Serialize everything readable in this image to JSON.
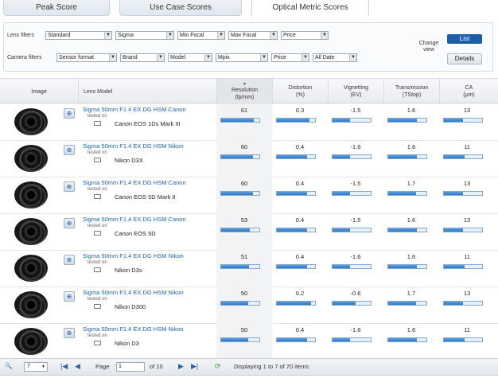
{
  "tabs": [
    "Peak Score",
    "Use Case Scores",
    "Optical Metric Scores"
  ],
  "filters": {
    "lens_label": "Lens filters",
    "lens": [
      {
        "value": "Standard"
      },
      {
        "value": "Sigma"
      },
      {
        "value": "Min Focal"
      },
      {
        "value": "Max Focal"
      },
      {
        "value": "Price"
      }
    ],
    "camera_label": "Camera filters",
    "camera": [
      {
        "value": "Sensor format"
      },
      {
        "value": "Brand"
      },
      {
        "value": "Model"
      },
      {
        "value": "Mpix"
      },
      {
        "value": "Price"
      },
      {
        "value": "All Date"
      }
    ],
    "change_view": "Change view",
    "list_label": "List",
    "details_label": "Details"
  },
  "columns": {
    "image": "Image",
    "model": "Lens Model",
    "resolution": [
      "Resolution",
      "(lp/mm)"
    ],
    "distortion": [
      "Distortion",
      "(%)"
    ],
    "vignetting": [
      "Vignetting",
      "(EV)"
    ],
    "transmission": [
      "Transmission",
      "(TStop)"
    ],
    "ca": [
      "CA",
      "(µm)"
    ]
  },
  "rows": [
    {
      "model": "Sigma 50mm F1.4 EX DG HSM Canon",
      "tested": "tested on",
      "camera": "Canon EOS 1Ds Mark III",
      "resolution": "61",
      "distortion": "0.3",
      "vignetting": "-1.5",
      "transmission": "1.6",
      "ca": "13",
      "bars": [
        0.85,
        0.85,
        0.45,
        0.75,
        0.5
      ]
    },
    {
      "model": "Sigma 50mm F1.4 EX DG HSM Nikon",
      "tested": "tested on",
      "camera": "Nikon D3X",
      "resolution": "60",
      "distortion": "0.4",
      "vignetting": "-1.6",
      "transmission": "1.6",
      "ca": "11",
      "bars": [
        0.84,
        0.8,
        0.45,
        0.75,
        0.55
      ]
    },
    {
      "model": "Sigma 50mm F1.4 EX DG HSM Canon",
      "tested": "tested on",
      "camera": "Canon EOS 5D Mark II",
      "resolution": "60",
      "distortion": "0.4",
      "vignetting": "-1.5",
      "transmission": "1.7",
      "ca": "13",
      "bars": [
        0.84,
        0.8,
        0.45,
        0.72,
        0.5
      ]
    },
    {
      "model": "Sigma 50mm F1.4 EX DG HSM Canon",
      "tested": "tested on",
      "camera": "Canon EOS 5D",
      "resolution": "53",
      "distortion": "0.4",
      "vignetting": "-1.5",
      "transmission": "1.6",
      "ca": "13",
      "bars": [
        0.74,
        0.8,
        0.45,
        0.75,
        0.5
      ]
    },
    {
      "model": "Sigma 50mm F1.4 EX DG HSM Nikon",
      "tested": "tested on",
      "camera": "Nikon D3s",
      "resolution": "51",
      "distortion": "0.4",
      "vignetting": "-1.6",
      "transmission": "1.6",
      "ca": "11",
      "bars": [
        0.72,
        0.8,
        0.45,
        0.75,
        0.55
      ]
    },
    {
      "model": "Sigma 50mm F1.4 EX DG HSM Nikon",
      "tested": "tested on",
      "camera": "Nikon D300",
      "resolution": "50",
      "distortion": "0.2",
      "vignetting": "-0.6",
      "transmission": "1.7",
      "ca": "13",
      "bars": [
        0.7,
        0.9,
        0.6,
        0.72,
        0.5
      ]
    },
    {
      "model": "Sigma 50mm F1.4 EX DG HSM Nikon",
      "tested": "tested on",
      "camera": "Nikon D3",
      "resolution": "50",
      "distortion": "0.4",
      "vignetting": "-1.6",
      "transmission": "1.6",
      "ca": "11",
      "bars": [
        0.7,
        0.8,
        0.45,
        0.75,
        0.55
      ]
    }
  ],
  "footer": {
    "per_page": "7",
    "page_label": "Page",
    "page_value": "1",
    "of_label": "of 10",
    "status": "Displaying 1 to 7 of 70 items"
  },
  "colors": {
    "accent": "#1b5ea8",
    "link": "#1c63b7",
    "bar_fill": "#3b86d1"
  }
}
